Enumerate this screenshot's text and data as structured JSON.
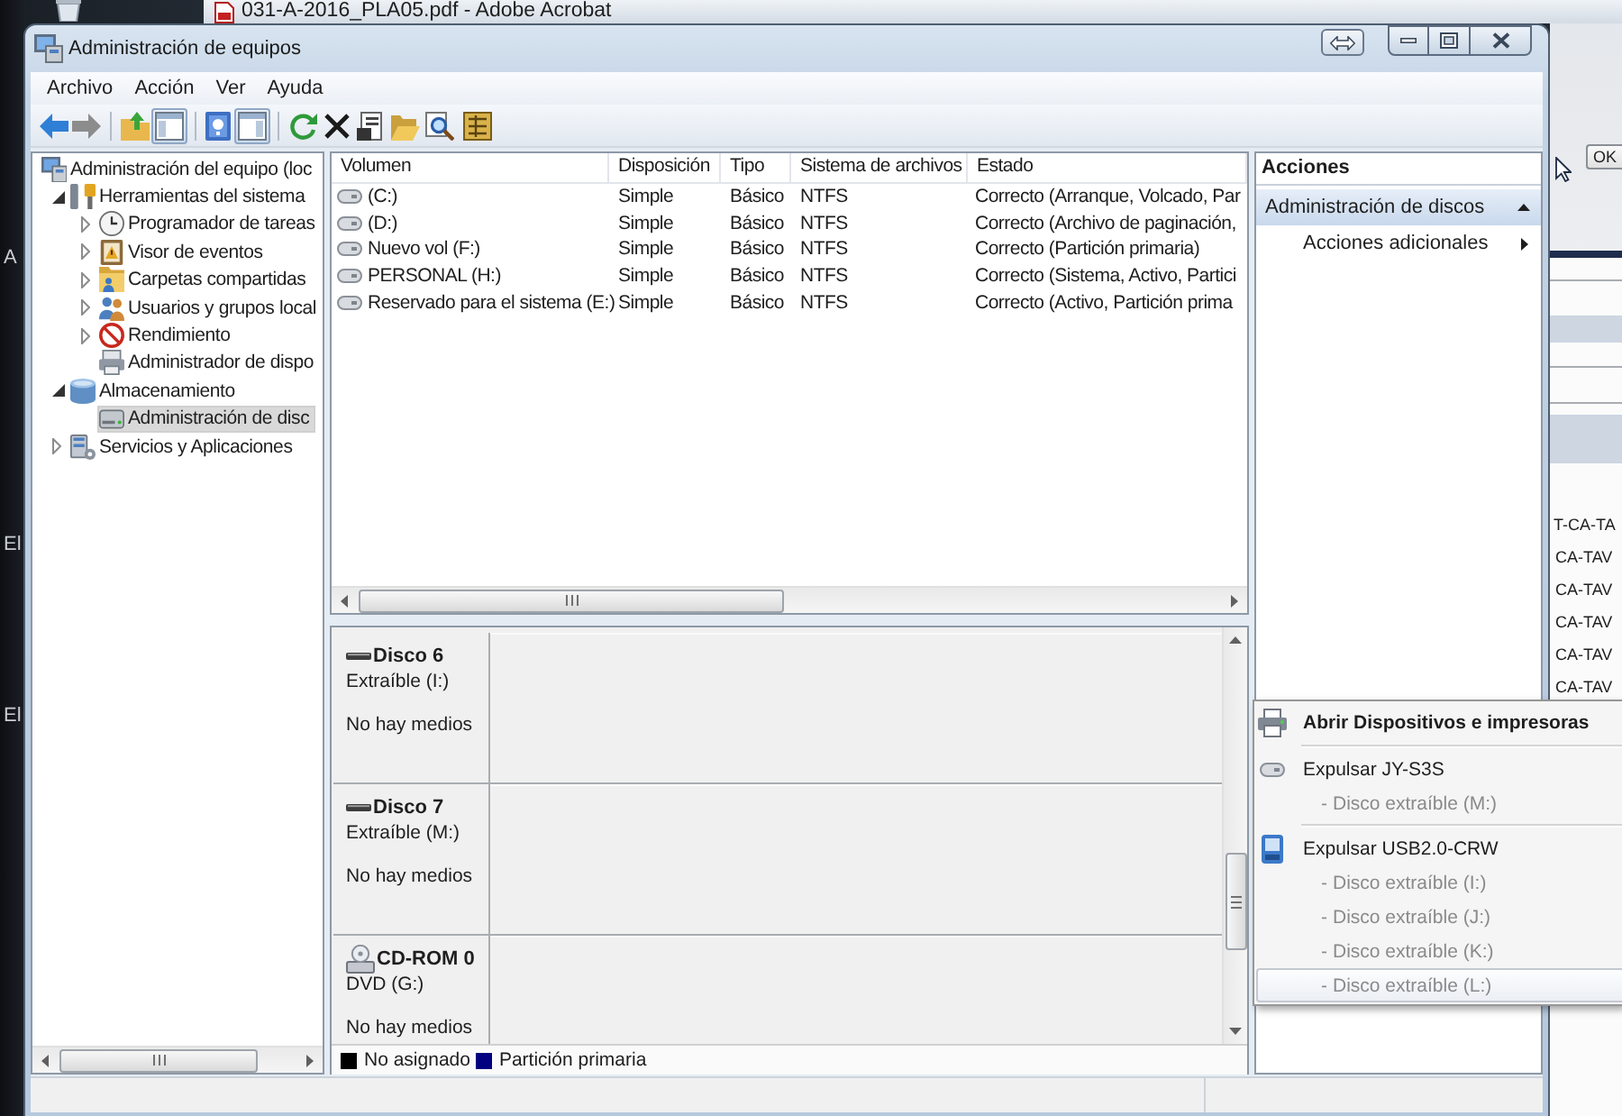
{
  "background": {
    "desktop_labels": [
      "A",
      "El",
      "El"
    ],
    "acrobat": {
      "title": "031-A-2016_PLA05.pdf - Adobe Acrobat",
      "button": "OK",
      "list": [
        "T-CA-TA",
        "CA-TAV",
        "CA-TAV",
        "CA-TAV",
        "CA-TAV",
        "CA-TAV"
      ]
    }
  },
  "window": {
    "title": "Administración de equipos"
  },
  "menu": [
    "Archivo",
    "Acción",
    "Ver",
    "Ayuda"
  ],
  "toolbar": {
    "console_tree_shown": true,
    "action_pane_shown": true
  },
  "tree": [
    {
      "kind": "computer",
      "label": "Administración del equipo (loc",
      "selected": false,
      "children": [
        {
          "kind": "tools",
          "label": "Herramientas del sistema",
          "expanded": true,
          "selected": false,
          "children": [
            {
              "kind": "scheduler",
              "label": "Programador de tareas",
              "expanded": false,
              "selected": false
            },
            {
              "kind": "events",
              "label": "Visor de eventos",
              "expanded": false,
              "selected": false
            },
            {
              "kind": "shares",
              "label": "Carpetas compartidas",
              "expanded": false,
              "selected": false
            },
            {
              "kind": "users",
              "label": "Usuarios y grupos local",
              "expanded": false,
              "selected": false
            },
            {
              "kind": "performance",
              "label": "Rendimiento",
              "expanded": false,
              "selected": false
            },
            {
              "kind": "devices",
              "label": "Administrador de dispo",
              "selected": false
            }
          ]
        },
        {
          "kind": "storage",
          "label": "Almacenamiento",
          "expanded": true,
          "selected": false,
          "children": [
            {
              "kind": "disks",
              "label": "Administración de disc",
              "selected": true
            }
          ]
        },
        {
          "kind": "services",
          "label": "Servicios y Aplicaciones",
          "expanded": false,
          "selected": false
        }
      ]
    }
  ],
  "volumes": {
    "columns": [
      "Volumen",
      "Disposición",
      "Tipo",
      "Sistema de archivos",
      "Estado"
    ],
    "rows": [
      [
        "(C:)",
        "Simple",
        "Básico",
        "NTFS",
        "Correcto (Arranque, Volcado, Par"
      ],
      [
        "(D:)",
        "Simple",
        "Básico",
        "NTFS",
        "Correcto (Archivo de paginación,"
      ],
      [
        "Nuevo vol (F:)",
        "Simple",
        "Básico",
        "NTFS",
        "Correcto (Partición primaria)"
      ],
      [
        "PERSONAL (H:)",
        "Simple",
        "Básico",
        "NTFS",
        "Correcto (Sistema, Activo, Partici"
      ],
      [
        "Reservado para el sistema (E:)",
        "Simple",
        "Básico",
        "NTFS",
        "Correcto (Activo, Partición prima"
      ]
    ]
  },
  "disks": [
    {
      "kind": "removable",
      "name": "Disco 6",
      "detail": "Extraíble (I:)",
      "media": "No hay medios"
    },
    {
      "kind": "removable",
      "name": "Disco 7",
      "detail": "Extraíble (M:)",
      "media": "No hay medios"
    },
    {
      "kind": "cdrom",
      "name": "CD-ROM 0",
      "detail": "DVD (G:)",
      "media": "No hay medios"
    }
  ],
  "legend": [
    {
      "label": "No asignado",
      "color": "#000000"
    },
    {
      "label": "Partición primaria",
      "color": "#000080"
    }
  ],
  "actions": {
    "title": "Acciones",
    "sections": [
      {
        "label": "Administración de discos",
        "expanded": true,
        "items": [
          {
            "label": "Acciones adicionales",
            "submenu": true
          }
        ]
      }
    ]
  },
  "context_menu": {
    "groups": [
      {
        "items": [
          {
            "kind": "devices",
            "label": "Abrir Dispositivos e impresoras",
            "default": true,
            "disabled": false,
            "selected": false
          }
        ]
      },
      {
        "items": [
          {
            "kind": "drive",
            "label": "Expulsar JY-S3S",
            "default": false,
            "disabled": false,
            "selected": false
          },
          {
            "kind": "volume",
            "marker": "-",
            "label": "Disco extraíble (M:)",
            "default": false,
            "disabled": true,
            "selected": false
          }
        ]
      },
      {
        "items": [
          {
            "kind": "card-reader",
            "label": "Expulsar USB2.0-CRW",
            "default": false,
            "disabled": false,
            "selected": false
          },
          {
            "kind": "volume",
            "marker": "-",
            "label": "Disco extraíble (I:)",
            "default": false,
            "disabled": true,
            "selected": false
          },
          {
            "kind": "volume",
            "marker": "-",
            "label": "Disco extraíble (J:)",
            "default": false,
            "disabled": true,
            "selected": false
          },
          {
            "kind": "volume",
            "marker": "-",
            "label": "Disco extraíble (K:)",
            "default": false,
            "disabled": true,
            "selected": false
          },
          {
            "kind": "volume",
            "marker": "-",
            "label": "Disco extraíble (L:)",
            "default": false,
            "disabled": true,
            "selected": true
          }
        ]
      }
    ]
  }
}
